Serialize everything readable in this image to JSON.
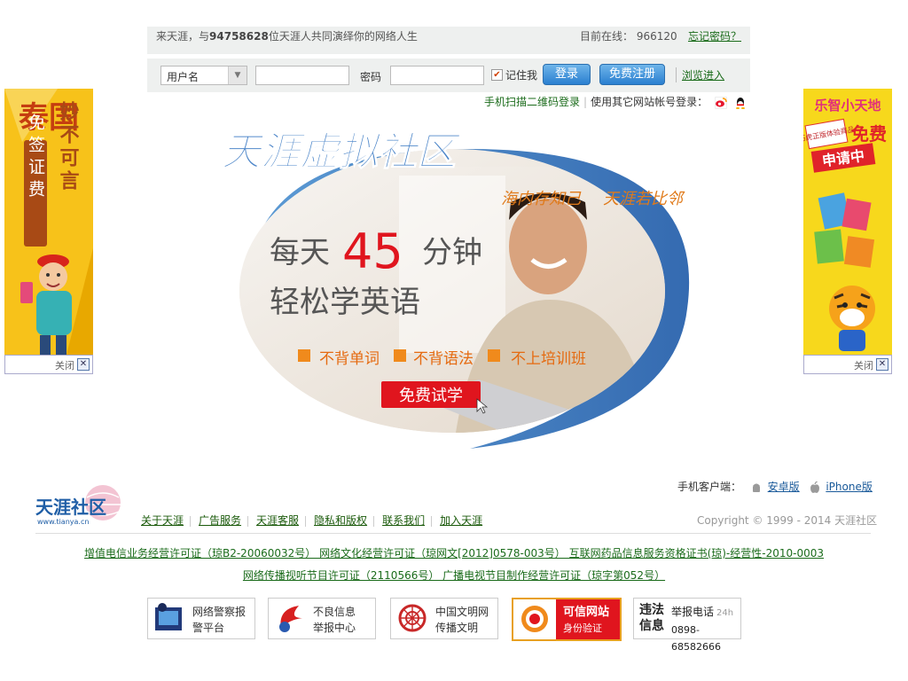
{
  "topbar": {
    "welcome_prefix": "来天涯，与",
    "member_count": "94758628",
    "welcome_suffix": "位天涯人共同演绎你的网络人生",
    "online_label": "目前在线：",
    "online_count": "966120",
    "forgot_password": "忘记密码？"
  },
  "login": {
    "username_select": "用户名",
    "password_label": "密码",
    "remember_me": "记住我",
    "login_button": "登录",
    "register_button": "免费注册",
    "browse_link": "浏览进入"
  },
  "qr_row": {
    "qr_login": "手机扫描二维码登录",
    "other_login": "使用其它网站帐号登录："
  },
  "left_ad": {
    "title": "泰国",
    "vertical_1": "免签证费",
    "vertical_2": "妙不可言",
    "close": "关闭"
  },
  "right_ad": {
    "brand": "乐智小天地",
    "badge": "巧虎正版体验商品",
    "free": "免费",
    "applying": "申请中",
    "close": "关闭"
  },
  "center_ad": {
    "brand": "天涯虚拟社区",
    "slogan_1": "海内存知己",
    "slogan_2": "天涯若比邻",
    "headline_prefix": "每天",
    "headline_number": "45",
    "headline_suffix": "分钟",
    "subheadline": "轻松学英语",
    "feature_1": "不背单词",
    "feature_2": "不背语法",
    "feature_3": "不上培训班",
    "cta": "免费试学"
  },
  "footer": {
    "app_label": "手机客户端：",
    "android": "安卓版",
    "iphone": "iPhone版",
    "logo_text": "天涯社区",
    "logo_domain": "www.tianya.cn",
    "nav": [
      "关于天涯",
      "广告服务",
      "天涯客服",
      "隐私和版权",
      "联系我们",
      "加入天涯"
    ],
    "copyright": "Copyright © 1999 - 2014 天涯社区",
    "license_line_1": "增值电信业务经营许可证（琼B2-20060032号） 网络文化经营许可证（琼网文[2012]0578-003号） 互联网药品信息服务资格证书(琼)-经营性-2010-0003",
    "license_line_2": "网络传播视听节目许可证（2110566号） 广播电视节目制作经营许可证（琼字第052号）"
  },
  "badges": [
    {
      "line1": "网络警察报",
      "line2": "警平台",
      "icon": "police-icon"
    },
    {
      "line1": "不良信息",
      "line2": "举报中心",
      "icon": "report-icon"
    },
    {
      "line1": "中国文明网",
      "line2": "传播文明",
      "icon": "civilization-icon"
    },
    {
      "line1": "可信网站",
      "line2": "身份验证",
      "icon": "trusted-site-icon"
    },
    {
      "line1": "举报电话",
      "line2": "0898-68582666",
      "tag": "违法",
      "tag2": "信息",
      "hours": "24h",
      "icon": "hotline-icon"
    }
  ],
  "colors": {
    "accent_blue": "#2a7fd0",
    "link_green": "#1a6b1a",
    "headline_red": "#e0151e",
    "ad_yellow": "#f5c518"
  }
}
